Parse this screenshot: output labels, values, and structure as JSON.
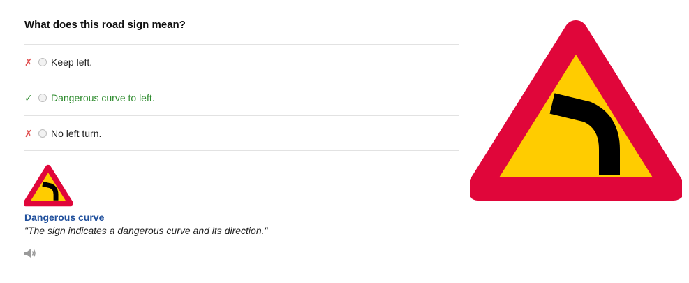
{
  "question": "What does this road sign mean?",
  "options": [
    {
      "mark": "✗",
      "status": "wrong",
      "label": "Keep left."
    },
    {
      "mark": "✓",
      "status": "correct",
      "label": "Dangerous curve to left."
    },
    {
      "mark": "✗",
      "status": "wrong",
      "label": "No left turn."
    }
  ],
  "explanation": {
    "title": "Dangerous curve",
    "quote": "\"The sign indicates a dangerous curve and its direction.\""
  },
  "icons": {
    "speaker": "speaker-icon",
    "sign": "dangerous-curve-left-sign"
  },
  "colors": {
    "sign_border": "#e0063a",
    "sign_fill": "#ffcc00",
    "correct": "#2e8b2e",
    "wrong": "#e05050",
    "link": "#1f4f9c"
  }
}
